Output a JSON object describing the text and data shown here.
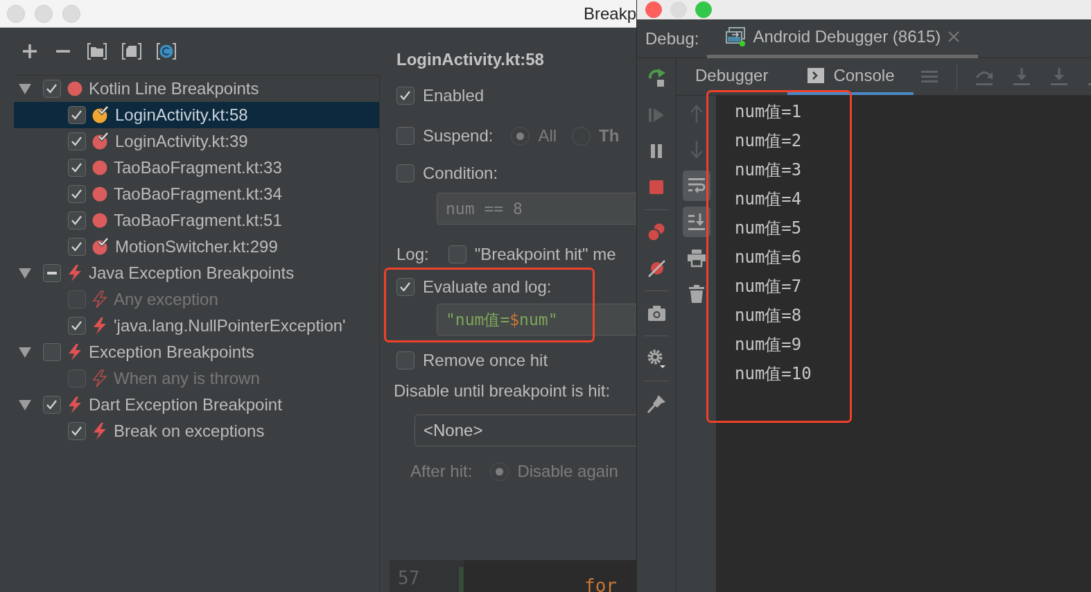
{
  "breakpoints_window": {
    "title": "Breakp",
    "tree": [
      {
        "label": "Kotlin Line Breakpoints",
        "expanded": true,
        "checked": true,
        "partial": false,
        "kind": "dot",
        "color": "#db5c5c",
        "children": [
          {
            "label": "LoginActivity.kt:58",
            "checked": true,
            "selected": true,
            "disabled": false,
            "kind": "dot-check",
            "color": "#f0a732"
          },
          {
            "label": "LoginActivity.kt:39",
            "checked": true,
            "selected": false,
            "disabled": false,
            "kind": "dot-check",
            "color": "#db5c5c"
          },
          {
            "label": "TaoBaoFragment.kt:33",
            "checked": true,
            "selected": false,
            "disabled": false,
            "kind": "dot",
            "color": "#db5c5c"
          },
          {
            "label": "TaoBaoFragment.kt:34",
            "checked": true,
            "selected": false,
            "disabled": false,
            "kind": "dot",
            "color": "#db5c5c"
          },
          {
            "label": "TaoBaoFragment.kt:51",
            "checked": true,
            "selected": false,
            "disabled": false,
            "kind": "dot",
            "color": "#db5c5c"
          },
          {
            "label": "MotionSwitcher.kt:299",
            "checked": true,
            "selected": false,
            "disabled": false,
            "kind": "dot-check",
            "color": "#db5c5c"
          }
        ]
      },
      {
        "label": "Java Exception Breakpoints",
        "expanded": true,
        "checked": true,
        "partial": true,
        "kind": "bolt",
        "children": [
          {
            "label": "Any exception",
            "checked": false,
            "selected": false,
            "disabled": true,
            "kind": "bolt"
          },
          {
            "label": "'java.lang.NullPointerException'",
            "checked": true,
            "selected": false,
            "disabled": false,
            "kind": "bolt"
          }
        ]
      },
      {
        "label": "Exception Breakpoints",
        "expanded": true,
        "checked": false,
        "partial": false,
        "kind": "bolt",
        "children": [
          {
            "label": "When any is thrown",
            "checked": false,
            "selected": false,
            "disabled": true,
            "kind": "bolt"
          }
        ]
      },
      {
        "label": "Dart Exception Breakpoint",
        "expanded": true,
        "checked": true,
        "partial": false,
        "kind": "bolt",
        "children": [
          {
            "label": "Break on exceptions",
            "checked": true,
            "selected": false,
            "disabled": false,
            "kind": "bolt"
          }
        ]
      }
    ],
    "details": {
      "title": "LoginActivity.kt:58",
      "enabled": {
        "label": "Enabled",
        "checked": true
      },
      "suspend": {
        "label": "Suspend:",
        "checked": false,
        "options": [
          {
            "label": "All",
            "selected": true
          },
          {
            "label": "Th",
            "selected": false
          }
        ]
      },
      "condition": {
        "label": "Condition:",
        "checked": false,
        "value": "num == 8"
      },
      "log": {
        "label": "Log:",
        "options": [
          {
            "label": "\"Breakpoint hit\" me",
            "checked": false
          }
        ]
      },
      "evaluate": {
        "label": "Evaluate and log:",
        "checked": true,
        "highlighted": true,
        "value": [
          {
            "text": "\"num值=",
            "kind": "string"
          },
          {
            "text": "$",
            "kind": "template"
          },
          {
            "text": "num\"",
            "kind": "string"
          }
        ]
      },
      "remove_once_hit": {
        "label": "Remove once hit",
        "checked": false
      },
      "disable_until": {
        "label": "Disable until breakpoint is hit:",
        "value": "<None>"
      },
      "after_hit": {
        "label": "After hit:",
        "disabled": true,
        "options": [
          {
            "label": "Disable again",
            "selected": true
          }
        ]
      },
      "editor": {
        "line_number": "57",
        "code": [
          {
            "text": "for",
            "kind": "keyword"
          }
        ]
      }
    }
  },
  "debug_window": {
    "label": "Debug:",
    "session_tab": {
      "label": "Android Debugger (8615)",
      "selected": true
    },
    "tabs": [
      {
        "label": "Debugger",
        "kind": "plain",
        "selected": false
      },
      {
        "label": "Console",
        "kind": "console",
        "selected": true
      }
    ],
    "console_tools": [
      {
        "kind": "up",
        "on": false,
        "disabled": true
      },
      {
        "kind": "down",
        "on": false,
        "disabled": true
      },
      {
        "kind": "wrap",
        "on": true,
        "disabled": false
      },
      {
        "kind": "scroll-end",
        "on": true,
        "disabled": false
      },
      {
        "kind": "print",
        "on": false,
        "disabled": false
      },
      {
        "kind": "trash",
        "on": false,
        "disabled": false
      }
    ],
    "console": {
      "highlighted": true,
      "lines": [
        "num值=1",
        "num值=2",
        "num值=3",
        "num值=4",
        "num值=5",
        "num值=6",
        "num值=7",
        "num值=8",
        "num值=9",
        "num值=10"
      ]
    }
  }
}
